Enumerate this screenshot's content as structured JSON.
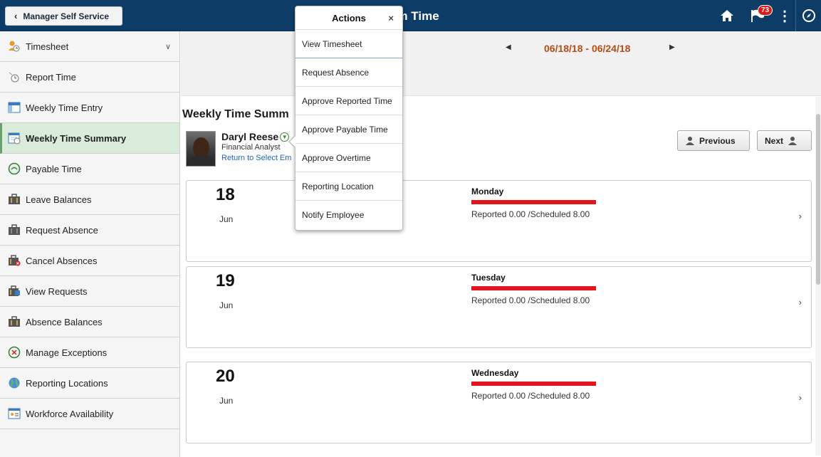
{
  "header": {
    "back_label": "Manager Self Service",
    "title_visible": "am Time",
    "notification_count": "73"
  },
  "sidebar": {
    "items": [
      {
        "label": "Timesheet",
        "icon": "timesheet-icon"
      },
      {
        "label": "Report Time",
        "icon": "clock-icon"
      },
      {
        "label": "Weekly Time Entry",
        "icon": "grid-icon"
      },
      {
        "label": "Weekly Time Summary",
        "icon": "calendar-icon"
      },
      {
        "label": "Payable Time",
        "icon": "payable-icon"
      },
      {
        "label": "Leave Balances",
        "icon": "briefcase-icon"
      },
      {
        "label": "Request Absence",
        "icon": "briefcase-icon"
      },
      {
        "label": "Cancel Absences",
        "icon": "briefcase-cancel-icon"
      },
      {
        "label": "View Requests",
        "icon": "briefcase-view-icon"
      },
      {
        "label": "Absence Balances",
        "icon": "briefcase-icon"
      },
      {
        "label": "Manage Exceptions",
        "icon": "exception-icon"
      },
      {
        "label": "Reporting Locations",
        "icon": "globe-icon"
      },
      {
        "label": "Workforce Availability",
        "icon": "workforce-icon"
      }
    ],
    "active_index": 3
  },
  "date_nav": {
    "range": "06/18/18 - 06/24/18"
  },
  "main": {
    "section_title": "Weekly Time Summ",
    "employee": {
      "name": "Daryl Reese",
      "job": "Financial Analyst",
      "return_link": "Return to Select Em"
    },
    "prev_label": "Previous",
    "next_label": "Next"
  },
  "days": [
    {
      "day": "18",
      "month": "Jun",
      "weekday": "Monday",
      "reported": "Reported 0.00 /Scheduled 8.00"
    },
    {
      "day": "19",
      "month": "Jun",
      "weekday": "Tuesday",
      "reported": "Reported 0.00 /Scheduled 8.00"
    },
    {
      "day": "20",
      "month": "Jun",
      "weekday": "Wednesday",
      "reported": "Reported 0.00 /Scheduled 8.00"
    }
  ],
  "actions_popup": {
    "title": "Actions",
    "close": "×",
    "items": [
      "View Timesheet",
      "Request Absence",
      "Approve Reported Time",
      "Approve Payable Time",
      "Approve Overtime",
      "Reporting Location",
      "Notify Employee"
    ]
  },
  "colors": {
    "header_bg": "#0d3c66",
    "active_item_bg": "#d9ecd9",
    "date_range": "#b34d16",
    "status_bar": "#e5141d",
    "link": "#1f63b8"
  }
}
